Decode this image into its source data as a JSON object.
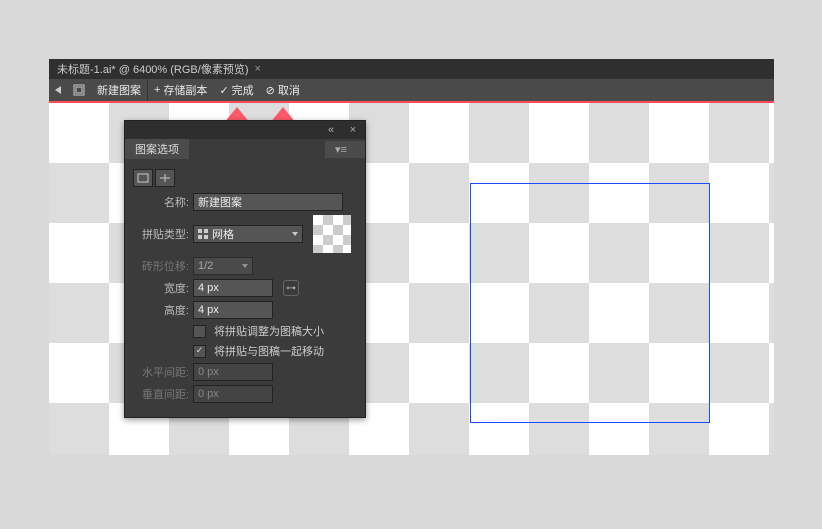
{
  "tab_title": "未标题-1.ai* @ 6400% (RGB/像素预览)",
  "toolbar": {
    "new_pattern": "新建图案",
    "save_copy": "存储副本",
    "done": "完成",
    "cancel": "取消"
  },
  "panel": {
    "title": "图案选项",
    "name_label": "名称:",
    "name_value": "新建图案",
    "tile_type_label": "拼贴类型:",
    "tile_type_value": "网格",
    "brick_offset_label": "砖形位移:",
    "brick_offset_value": "1/2",
    "width_label": "宽度:",
    "width_value": "4 px",
    "height_label": "高度:",
    "height_value": "4 px",
    "fit_tile_label": "将拼贴调整为图稿大小",
    "move_with_art_label": "将拼贴与图稿一起移动",
    "move_with_art_checked": "✓",
    "hspacing_label": "水平间距:",
    "hspacing_value": "0 px",
    "vspacing_label": "垂直间距:",
    "vspacing_value": "0 px"
  }
}
